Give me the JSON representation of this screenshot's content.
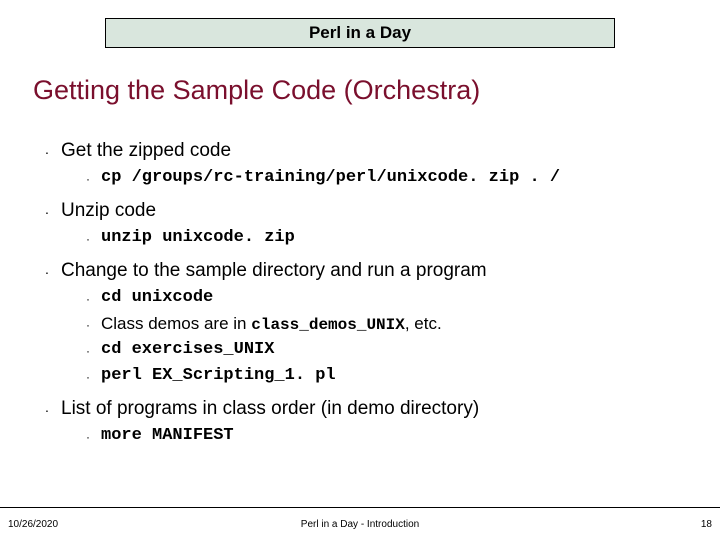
{
  "header": "Perl in a Day",
  "title": "Getting the Sample Code (Orchestra)",
  "items": [
    {
      "text": "Get the zipped code"
    },
    {
      "sub": true,
      "code": true,
      "text": "cp /groups/rc-training/perl/unixcode. zip . /"
    },
    {
      "text": "Unzip code"
    },
    {
      "sub": true,
      "code": true,
      "text": "unzip unixcode. zip"
    },
    {
      "text": "Change to the sample directory  and run a program"
    },
    {
      "sub": true,
      "code": true,
      "text": "cd unixcode"
    },
    {
      "sub": true,
      "mixed": true,
      "pre": "Class demos are in ",
      "code_text": "class_demos_UNIX",
      "post": ", etc."
    },
    {
      "sub": true,
      "code": true,
      "text": "cd exercises_UNIX"
    },
    {
      "sub": true,
      "code": true,
      "text": "perl EX_Scripting_1. pl"
    },
    {
      "text": "List of programs in class order (in demo directory)"
    },
    {
      "sub": true,
      "code": true,
      "text": "more MANIFEST"
    }
  ],
  "footer": {
    "date": "10/26/2020",
    "center": "Perl in a Day - Introduction",
    "page": "18"
  }
}
